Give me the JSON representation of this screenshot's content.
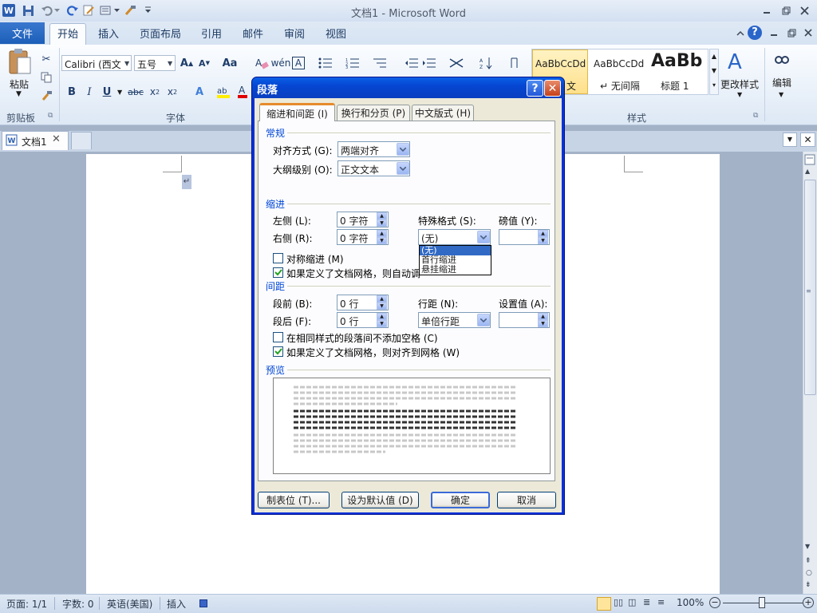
{
  "window": {
    "title": "文档1  -  Microsoft Word"
  },
  "tabs": {
    "file": "文件",
    "home": "开始",
    "insert": "插入",
    "layout": "页面布局",
    "references": "引用",
    "mailings": "邮件",
    "review": "审阅",
    "view": "视图"
  },
  "ribbon": {
    "paste_label": "粘贴",
    "clipboard_group": "剪贴板",
    "font_group": "字体",
    "styles_group": "样式",
    "font_name": "Calibri (西文",
    "font_size": "五号",
    "styles": [
      {
        "sample": "AaBbCcDd",
        "label": "文"
      },
      {
        "sample": "AaBbCcDd",
        "label": "↵ 无间隔"
      },
      {
        "sample": "AaBb",
        "label": "标题 1"
      }
    ],
    "change_styles": "更改样式",
    "edit": "编辑"
  },
  "doc_tab": {
    "name": "文档1"
  },
  "dialog": {
    "title": "段落",
    "tabs": [
      "缩进和间距 (I)",
      "换行和分页 (P)",
      "中文版式 (H)"
    ],
    "general": {
      "section": "常规",
      "alignment_label": "对齐方式 (G):",
      "alignment_value": "两端对齐",
      "outline_label": "大纲级别 (O):",
      "outline_value": "正文文本"
    },
    "indent": {
      "section": "缩进",
      "left_label": "左侧 (L):",
      "left_value": "0 字符",
      "right_label": "右侧 (R):",
      "right_value": "0 字符",
      "special_label": "特殊格式 (S):",
      "special_value": "(无)",
      "by_label": "磅值 (Y):",
      "mirror_label": "对称缩进 (M)",
      "auto_adjust_label": "如果定义了文档网格，则自动调",
      "special_options": [
        "(无)",
        "首行缩进",
        "悬挂缩进"
      ]
    },
    "spacing": {
      "section": "间距",
      "before_label": "段前 (B):",
      "before_value": "0 行",
      "after_label": "段后 (F):",
      "after_value": "0 行",
      "line_label": "行距 (N):",
      "line_value": "单倍行距",
      "at_label": "设置值 (A):",
      "no_space_label": "在相同样式的段落间不添加空格 (C)",
      "snap_grid_label": "如果定义了文档网格，则对齐到网格 (W)"
    },
    "preview": {
      "section": "预览"
    },
    "buttons": {
      "tabs": "制表位 (T)...",
      "default": "设为默认值 (D)",
      "ok": "确定",
      "cancel": "取消"
    }
  },
  "status": {
    "page": "页面: 1/1",
    "words": "字数: 0",
    "language": "英语(美国)",
    "mode": "插入",
    "zoom": "100%"
  }
}
